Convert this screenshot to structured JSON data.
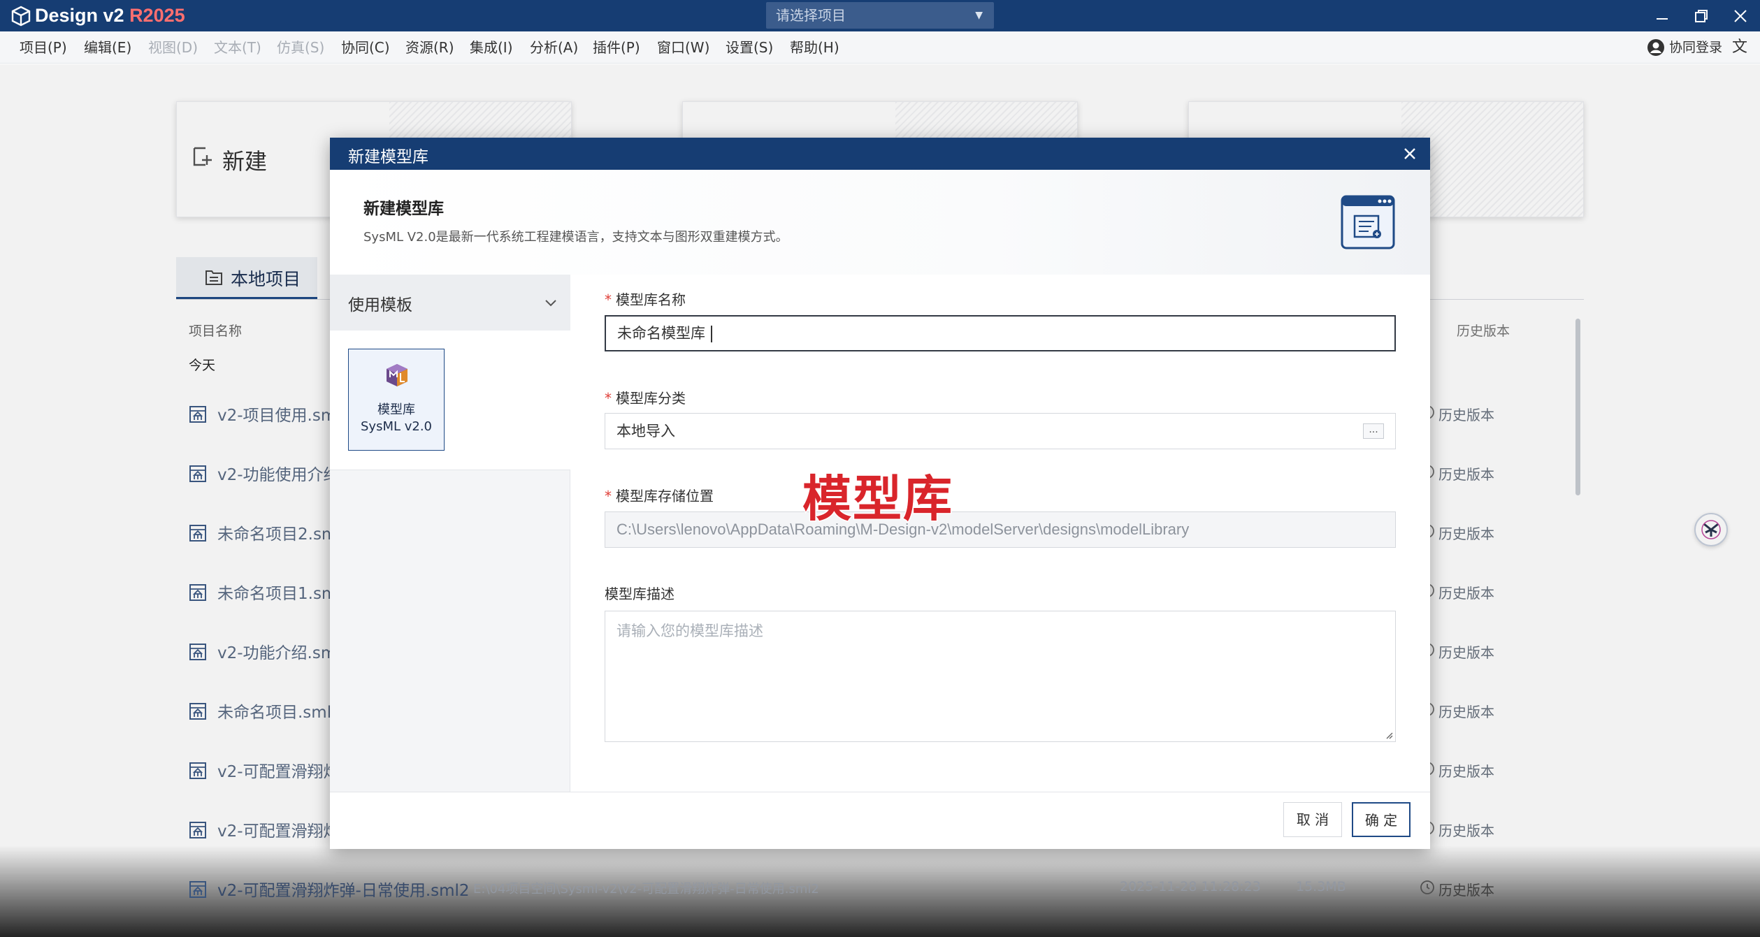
{
  "app": {
    "title_main": "Design v2 ",
    "title_r": "R2025"
  },
  "project_select": {
    "placeholder": "请选择项目"
  },
  "menu": {
    "items": [
      {
        "label": "项目(P)",
        "disabled": false
      },
      {
        "label": "编辑(E)",
        "disabled": false
      },
      {
        "label": "视图(D)",
        "disabled": true
      },
      {
        "label": "文本(T)",
        "disabled": true
      },
      {
        "label": "仿真(S)",
        "disabled": true
      },
      {
        "label": "协同(C)",
        "disabled": false
      },
      {
        "label": "资源(R)",
        "disabled": false
      },
      {
        "label": "集成(I)",
        "disabled": false
      },
      {
        "label": "分析(A)",
        "disabled": false
      },
      {
        "label": "插件(P)",
        "disabled": false
      },
      {
        "label": "窗口(W)",
        "disabled": false
      },
      {
        "label": "设置(S)",
        "disabled": false
      },
      {
        "label": "帮助(H)",
        "disabled": false
      }
    ],
    "collab_login": "协同登录"
  },
  "home": {
    "new_label": "新建",
    "tab_local": "本地项目",
    "col_name": "项目名称",
    "col_history": "历史版本",
    "group_today": "今天",
    "history_label": "历史版本",
    "rows": [
      {
        "name": "v2-项目使用.sm"
      },
      {
        "name": "v2-功能使用介绍"
      },
      {
        "name": "未命名项目2.sm"
      },
      {
        "name": "未命名项目1.sm"
      },
      {
        "name": "v2-功能介绍.sm"
      },
      {
        "name": "未命名项目.sml2"
      },
      {
        "name": "v2-可配置滑翔炸"
      },
      {
        "name": "v2-可配置滑翔炸"
      }
    ],
    "last_row": {
      "name": "v2-可配置滑翔炸弹-日常使用.sml2",
      "path": "E:\\04项目空间\\Sysml-v2\\v2-可配置滑翔炸弹-日常使用.sml2",
      "time": "2025-11-28 11:28:23",
      "size": "15.3MB"
    }
  },
  "dialog": {
    "title": "新建模型库",
    "head_title": "新建模型库",
    "head_subtitle": "SysML V2.0是最新一代系统工程建模语言，支持文本与图形双重建模方式。",
    "side_header": "使用模板",
    "template": {
      "line1": "模型库",
      "line2": "SysML v2.0"
    },
    "name_label": "模型库名称",
    "name_value": "未命名模型库",
    "category_label": "模型库分类",
    "category_value": "本地导入",
    "more_label": "...",
    "location_label": "模型库存储位置",
    "location_value": "C:\\Users\\lenovo\\AppData\\Roaming\\M-Design-v2\\modelServer\\designs\\modelLibrary",
    "desc_label": "模型库描述",
    "desc_placeholder": "请输入您的模型库描述",
    "cancel": "取 消",
    "ok": "确 定",
    "required_mark": "*"
  },
  "overlay_caption": "模型库",
  "colors": {
    "titlebar": "#163d73",
    "accent": "#1f4a86",
    "required": "#e0403a",
    "caption": "#d9252b"
  }
}
